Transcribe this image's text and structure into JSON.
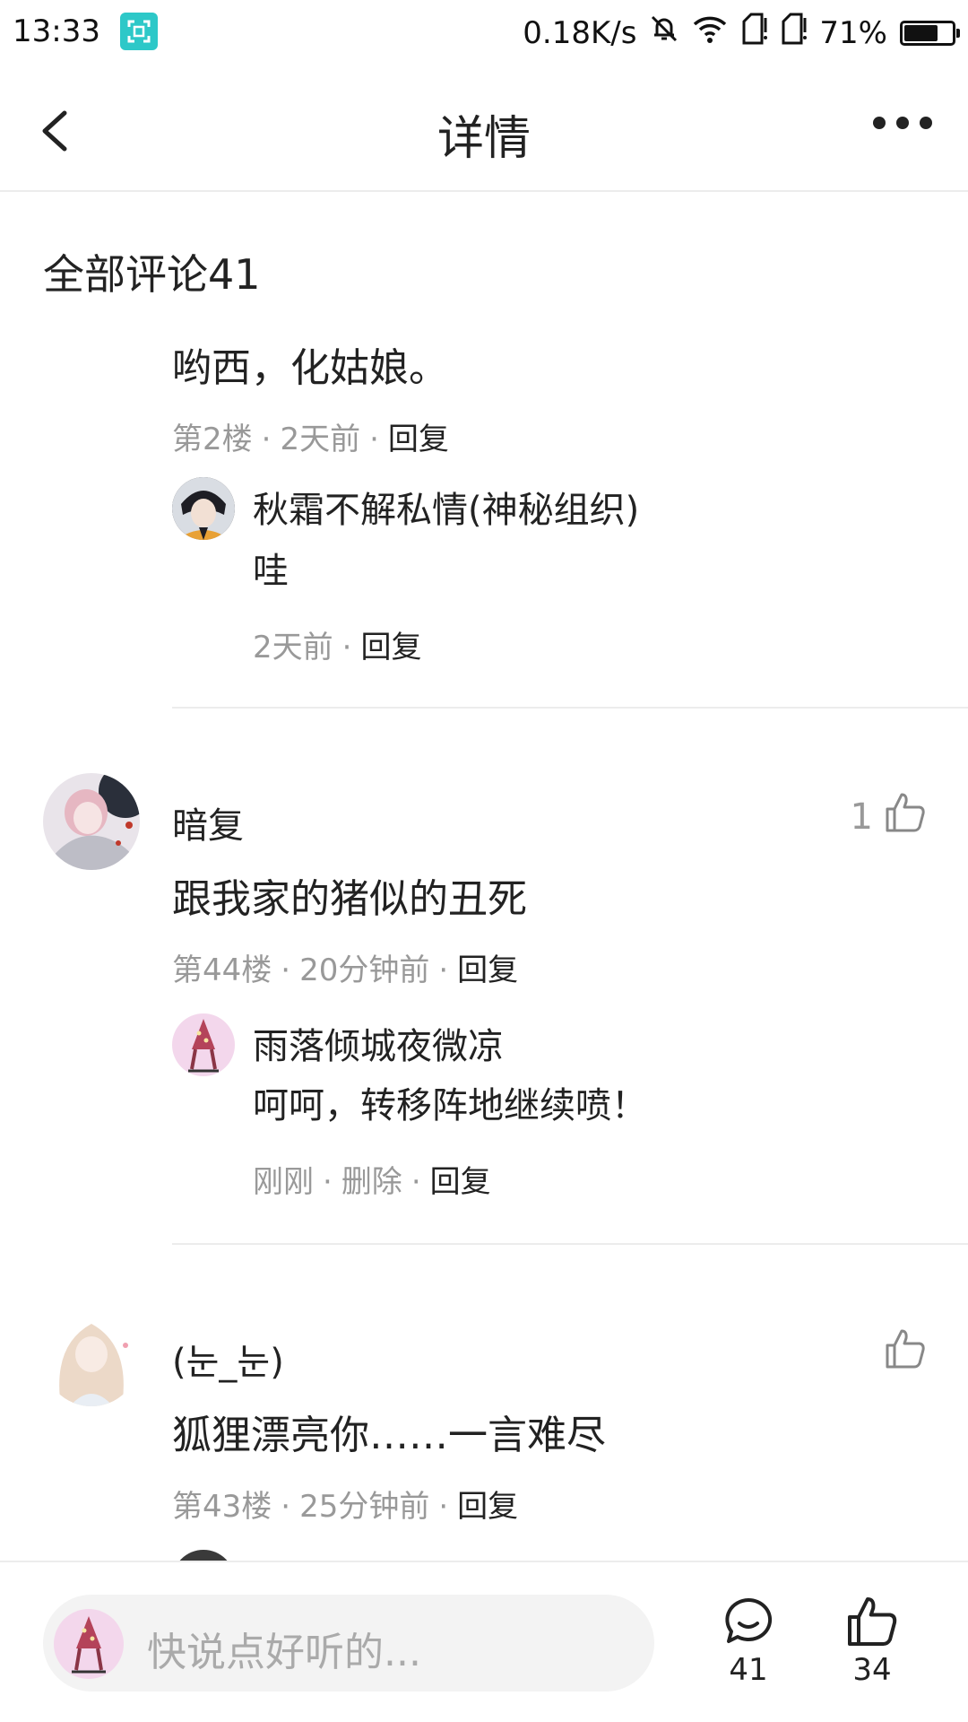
{
  "status_bar": {
    "time": "13:33",
    "net_speed": "0.18K/s",
    "battery_percent": "71%",
    "battery_level": 0.71,
    "icons": [
      "screenshot-icon",
      "mute-bell-icon",
      "wifi-icon",
      "sim1-icon",
      "sim2-icon",
      "battery-icon"
    ]
  },
  "header": {
    "title": "详情",
    "back_icon": "chevron-left-icon",
    "more_icon": "more-dots-icon"
  },
  "comments_section": {
    "title": "全部评论41",
    "partial_comment": {
      "text": "哟西，化姑娘。",
      "floor": "第2楼",
      "time": "2天前",
      "reply_label": "回复",
      "replies": [
        {
          "author": "秋霜不解私情(神秘组织)",
          "text": "哇",
          "time": "2天前",
          "reply_label": "回复"
        }
      ]
    },
    "comments": [
      {
        "author": "暗复",
        "text": "跟我家的猪似的丑死",
        "floor": "第44楼",
        "time": "20分钟前",
        "reply_label": "回复",
        "likes": "1",
        "replies": [
          {
            "author": "雨落倾城夜微凉",
            "text": "呵呵，转移阵地继续喷！",
            "time": "刚刚",
            "delete_label": "删除",
            "reply_label": "回复"
          }
        ]
      },
      {
        "author": "(눈_눈)",
        "text": "狐狸漂亮你……一言难尽",
        "floor": "第43楼",
        "time": "25分钟前",
        "reply_label": "回复",
        "likes": ""
      }
    ]
  },
  "bottom_bar": {
    "input_placeholder": "快说点好听的...",
    "comment_count": "41",
    "like_count": "34"
  }
}
